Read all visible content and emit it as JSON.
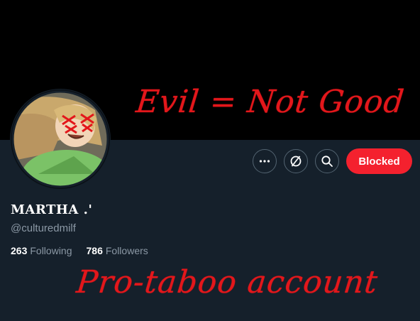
{
  "annotations": {
    "top": "Evil = Not Good",
    "bottom": "Pro-taboo account"
  },
  "profile": {
    "display_name": "MARTHA .'",
    "handle": "@culturedmilf",
    "following_count": "263",
    "following_label": "Following",
    "followers_count": "786",
    "followers_label": "Followers"
  },
  "actions": {
    "more_icon": "more-horizontal-icon",
    "stop_icon": "no-sign-icon",
    "search_icon": "search-icon",
    "blocked_label": "Blocked"
  },
  "colors": {
    "background": "#15202b",
    "banner": "#000000",
    "blocked": "#f4212e",
    "annotation": "#e3171b",
    "muted_text": "#8b98a5"
  }
}
